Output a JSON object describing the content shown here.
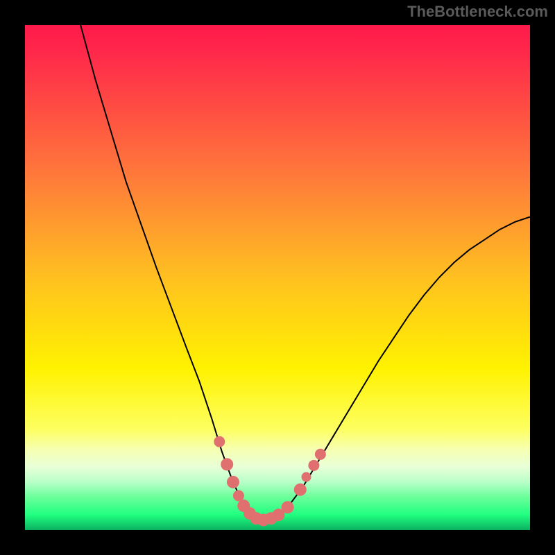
{
  "watermark": "TheBottleneck.com",
  "chart_data": {
    "type": "line",
    "title": "",
    "xlabel": "",
    "ylabel": "",
    "xlim": [
      0,
      100
    ],
    "ylim": [
      0,
      100
    ],
    "background_gradient": {
      "stops": [
        {
          "offset": 0.0,
          "color": "#ff1a4b"
        },
        {
          "offset": 0.06,
          "color": "#ff2a4a"
        },
        {
          "offset": 0.3,
          "color": "#ff7a3a"
        },
        {
          "offset": 0.5,
          "color": "#ffc020"
        },
        {
          "offset": 0.68,
          "color": "#fff200"
        },
        {
          "offset": 0.8,
          "color": "#fdff60"
        },
        {
          "offset": 0.84,
          "color": "#f6ffb0"
        },
        {
          "offset": 0.875,
          "color": "#e8ffd8"
        },
        {
          "offset": 0.905,
          "color": "#b8ffc8"
        },
        {
          "offset": 0.935,
          "color": "#6aff9a"
        },
        {
          "offset": 0.97,
          "color": "#20ff80"
        },
        {
          "offset": 1.0,
          "color": "#0cb060"
        }
      ]
    },
    "series": [
      {
        "name": "bottleneck-curve",
        "color": "#000000",
        "stroke_width": 2,
        "x": [
          11,
          14,
          17,
          20,
          23,
          26,
          29,
          32,
          34.5,
          37,
          39,
          41,
          43,
          45,
          47,
          49,
          52,
          55,
          58,
          61,
          64,
          67,
          70,
          73,
          76,
          79,
          82,
          85,
          88,
          91,
          94,
          97,
          100
        ],
        "y": [
          100,
          89,
          79,
          69,
          60.5,
          52,
          44,
          36,
          29.5,
          22,
          15.5,
          10,
          5.5,
          3,
          2,
          2.5,
          4.5,
          8.5,
          13.5,
          18.5,
          23.5,
          28.5,
          33.5,
          38,
          42.5,
          46.5,
          50,
          53,
          55.5,
          57.5,
          59.5,
          61,
          62
        ]
      }
    ],
    "markers": {
      "name": "highlight-dots",
      "color": "#e07070",
      "radius_main": 8,
      "points": [
        {
          "x": 38.5,
          "y": 17.5,
          "r": 8
        },
        {
          "x": 40.0,
          "y": 13.0,
          "r": 9
        },
        {
          "x": 41.2,
          "y": 9.5,
          "r": 9
        },
        {
          "x": 42.3,
          "y": 6.8,
          "r": 8
        },
        {
          "x": 43.3,
          "y": 4.8,
          "r": 9
        },
        {
          "x": 44.5,
          "y": 3.3,
          "r": 9
        },
        {
          "x": 45.8,
          "y": 2.3,
          "r": 9
        },
        {
          "x": 47.2,
          "y": 2.0,
          "r": 9
        },
        {
          "x": 48.7,
          "y": 2.3,
          "r": 9
        },
        {
          "x": 50.2,
          "y": 3.0,
          "r": 9
        },
        {
          "x": 52.0,
          "y": 4.5,
          "r": 9
        },
        {
          "x": 54.5,
          "y": 8.0,
          "r": 9
        },
        {
          "x": 55.7,
          "y": 10.5,
          "r": 7
        },
        {
          "x": 57.2,
          "y": 12.8,
          "r": 8
        },
        {
          "x": 58.5,
          "y": 15.0,
          "r": 8
        }
      ]
    }
  }
}
